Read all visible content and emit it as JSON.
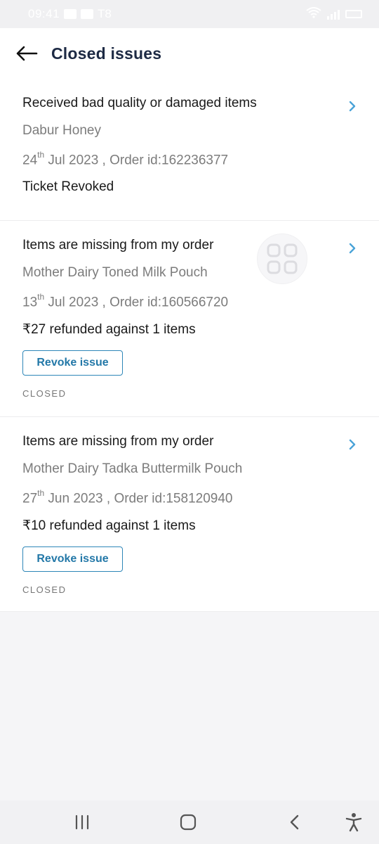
{
  "status_bar": {
    "time": "09:41",
    "network": "T8"
  },
  "header": {
    "title": "Closed issues"
  },
  "issues": [
    {
      "title": "Received bad quality or damaged items",
      "product": "Dabur Honey",
      "day": "24",
      "day_suffix": "th",
      "date_rest": " Jul 2023 , Order id:162236377",
      "status_line": "Ticket Revoked"
    },
    {
      "title": "Items are missing from my order",
      "product": "Mother Dairy Toned Milk Pouch",
      "day": "13",
      "day_suffix": "th",
      "date_rest": " Jul 2023 , Order id:160566720",
      "status_line": "₹27 refunded against 1 items",
      "revoke_label": "Revoke issue",
      "closed_label": "CLOSED"
    },
    {
      "title": "Items are missing from my order",
      "product": "Mother Dairy Tadka Buttermilk Pouch",
      "day": "27",
      "day_suffix": "th",
      "date_rest": " Jun 2023 , Order id:158120940",
      "status_line": "₹10 refunded against 1 items",
      "revoke_label": "Revoke issue",
      "closed_label": "CLOSED"
    }
  ],
  "icons": {
    "back": "arrow-left-icon",
    "chevron": "chevron-right-icon",
    "floating": "grid-icon",
    "nav_recents": "recents-icon",
    "nav_home": "home-icon",
    "nav_back": "back-icon",
    "nav_accessibility": "accessibility-icon"
  },
  "colors": {
    "title": "#1d2a44",
    "accent": "#2e86b8",
    "chevron": "#4aa3d8",
    "muted": "#7c7c7c",
    "background": "#f5f5f7"
  }
}
